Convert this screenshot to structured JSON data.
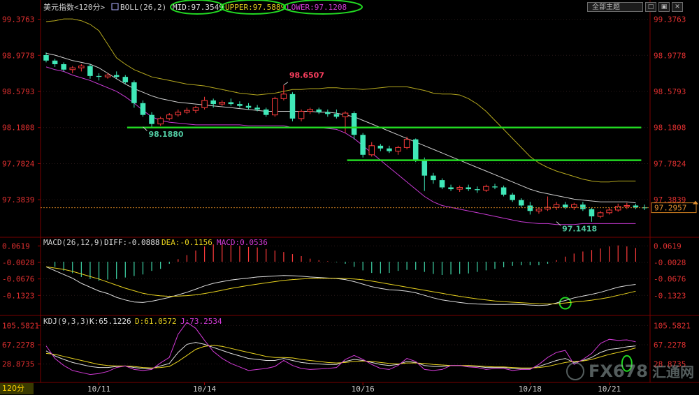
{
  "toolbar": {
    "theme_select": "全部主题",
    "btn1": "□",
    "btn2": "▣",
    "btn3": "✕"
  },
  "period_label": "120分",
  "watermark": {
    "brand": "FX678",
    "cn": "汇通网"
  },
  "chart_data": {
    "type": "candlestick",
    "title": "美元指数<120分>",
    "main": {
      "boll_label": "BOLL(26,2)",
      "mid_label": "MID:97.3549",
      "upper_label": "UPPER:97.5889",
      "lower_label": "LOWER:97.1208",
      "y_ticks": [
        "99.3763",
        "98.9778",
        "98.5793",
        "98.1808",
        "97.7824",
        "97.3839"
      ],
      "ylim": [
        97.0,
        99.45
      ],
      "last_price": "97.2957",
      "last_value": 97.2957,
      "annotations": [
        {
          "text": "98.6507",
          "value": 98.6507,
          "index": 27
        },
        {
          "text": "98.1880",
          "value": 98.188,
          "index": 11
        },
        {
          "text": "97.1418",
          "value": 97.1418,
          "index": 58
        }
      ],
      "hlines": [
        {
          "value": 98.1808,
          "from": 10,
          "to": 67
        },
        {
          "value": 97.82,
          "from": 35,
          "to": 67
        }
      ],
      "candles": [
        {
          "o": 98.98,
          "h": 99.01,
          "l": 98.9,
          "c": 98.92
        },
        {
          "o": 98.92,
          "h": 98.94,
          "l": 98.85,
          "c": 98.88
        },
        {
          "o": 98.88,
          "h": 98.9,
          "l": 98.8,
          "c": 98.82
        },
        {
          "o": 98.82,
          "h": 98.86,
          "l": 98.78,
          "c": 98.84
        },
        {
          "o": 98.84,
          "h": 98.88,
          "l": 98.8,
          "c": 98.86
        },
        {
          "o": 98.86,
          "h": 98.88,
          "l": 98.72,
          "c": 98.75
        },
        {
          "o": 98.75,
          "h": 98.78,
          "l": 98.7,
          "c": 98.74
        },
        {
          "o": 98.74,
          "h": 98.78,
          "l": 98.72,
          "c": 98.76
        },
        {
          "o": 98.76,
          "h": 98.8,
          "l": 98.72,
          "c": 98.74
        },
        {
          "o": 98.74,
          "h": 98.76,
          "l": 98.66,
          "c": 98.68
        },
        {
          "o": 98.68,
          "h": 98.7,
          "l": 98.4,
          "c": 98.45
        },
        {
          "o": 98.45,
          "h": 98.48,
          "l": 98.3,
          "c": 98.32
        },
        {
          "o": 98.32,
          "h": 98.35,
          "l": 98.19,
          "c": 98.22
        },
        {
          "o": 98.22,
          "h": 98.3,
          "l": 98.2,
          "c": 98.28
        },
        {
          "o": 98.28,
          "h": 98.34,
          "l": 98.26,
          "c": 98.32
        },
        {
          "o": 98.32,
          "h": 98.38,
          "l": 98.3,
          "c": 98.35
        },
        {
          "o": 98.35,
          "h": 98.4,
          "l": 98.33,
          "c": 98.37
        },
        {
          "o": 98.37,
          "h": 98.42,
          "l": 98.34,
          "c": 98.4
        },
        {
          "o": 98.4,
          "h": 98.52,
          "l": 98.38,
          "c": 98.48
        },
        {
          "o": 98.48,
          "h": 98.5,
          "l": 98.4,
          "c": 98.44
        },
        {
          "o": 98.44,
          "h": 98.48,
          "l": 98.42,
          "c": 98.46
        },
        {
          "o": 98.46,
          "h": 98.5,
          "l": 98.42,
          "c": 98.44
        },
        {
          "o": 98.44,
          "h": 98.47,
          "l": 98.4,
          "c": 98.42
        },
        {
          "o": 98.42,
          "h": 98.45,
          "l": 98.38,
          "c": 98.4
        },
        {
          "o": 98.4,
          "h": 98.43,
          "l": 98.36,
          "c": 98.38
        },
        {
          "o": 98.38,
          "h": 98.4,
          "l": 98.3,
          "c": 98.32
        },
        {
          "o": 98.32,
          "h": 98.52,
          "l": 98.3,
          "c": 98.5
        },
        {
          "o": 98.5,
          "h": 98.65,
          "l": 98.48,
          "c": 98.55
        },
        {
          "o": 98.55,
          "h": 98.57,
          "l": 98.25,
          "c": 98.28
        },
        {
          "o": 98.28,
          "h": 98.38,
          "l": 98.25,
          "c": 98.36
        },
        {
          "o": 98.36,
          "h": 98.4,
          "l": 98.33,
          "c": 98.38
        },
        {
          "o": 98.38,
          "h": 98.4,
          "l": 98.33,
          "c": 98.35
        },
        {
          "o": 98.35,
          "h": 98.38,
          "l": 98.3,
          "c": 98.33
        },
        {
          "o": 98.33,
          "h": 98.38,
          "l": 98.28,
          "c": 98.3
        },
        {
          "o": 98.3,
          "h": 98.36,
          "l": 98.12,
          "c": 98.34
        },
        {
          "o": 98.34,
          "h": 98.36,
          "l": 98.05,
          "c": 98.1
        },
        {
          "o": 98.1,
          "h": 98.12,
          "l": 97.85,
          "c": 97.88
        },
        {
          "o": 97.88,
          "h": 98.02,
          "l": 97.86,
          "c": 97.98
        },
        {
          "o": 97.98,
          "h": 98.0,
          "l": 97.92,
          "c": 97.95
        },
        {
          "o": 97.95,
          "h": 97.98,
          "l": 97.9,
          "c": 97.92
        },
        {
          "o": 97.92,
          "h": 97.98,
          "l": 97.88,
          "c": 97.96
        },
        {
          "o": 97.96,
          "h": 98.08,
          "l": 97.94,
          "c": 98.05
        },
        {
          "o": 98.05,
          "h": 98.06,
          "l": 97.8,
          "c": 97.82
        },
        {
          "o": 97.82,
          "h": 97.85,
          "l": 97.48,
          "c": 97.65
        },
        {
          "o": 97.65,
          "h": 97.68,
          "l": 97.56,
          "c": 97.6
        },
        {
          "o": 97.6,
          "h": 97.62,
          "l": 97.5,
          "c": 97.52
        },
        {
          "o": 97.52,
          "h": 97.55,
          "l": 97.48,
          "c": 97.5
        },
        {
          "o": 97.5,
          "h": 97.54,
          "l": 97.47,
          "c": 97.52
        },
        {
          "o": 97.52,
          "h": 97.55,
          "l": 97.48,
          "c": 97.5
        },
        {
          "o": 97.5,
          "h": 97.53,
          "l": 97.46,
          "c": 97.49
        },
        {
          "o": 97.49,
          "h": 97.55,
          "l": 97.47,
          "c": 97.53
        },
        {
          "o": 97.53,
          "h": 97.56,
          "l": 97.5,
          "c": 97.52
        },
        {
          "o": 97.52,
          "h": 97.54,
          "l": 97.42,
          "c": 97.44
        },
        {
          "o": 97.44,
          "h": 97.46,
          "l": 97.36,
          "c": 97.38
        },
        {
          "o": 97.38,
          "h": 97.4,
          "l": 97.3,
          "c": 97.32
        },
        {
          "o": 97.32,
          "h": 97.36,
          "l": 97.22,
          "c": 97.26
        },
        {
          "o": 97.26,
          "h": 97.3,
          "l": 97.23,
          "c": 97.28
        },
        {
          "o": 97.28,
          "h": 97.42,
          "l": 97.26,
          "c": 97.3
        },
        {
          "o": 97.3,
          "h": 97.36,
          "l": 97.27,
          "c": 97.33
        },
        {
          "o": 97.33,
          "h": 97.36,
          "l": 97.28,
          "c": 97.3
        },
        {
          "o": 97.3,
          "h": 97.35,
          "l": 97.27,
          "c": 97.33
        },
        {
          "o": 97.33,
          "h": 97.36,
          "l": 97.26,
          "c": 97.28
        },
        {
          "o": 97.28,
          "h": 97.3,
          "l": 97.14,
          "c": 97.2
        },
        {
          "o": 97.2,
          "h": 97.26,
          "l": 97.18,
          "c": 97.24
        },
        {
          "o": 97.24,
          "h": 97.3,
          "l": 97.22,
          "c": 97.27
        },
        {
          "o": 97.27,
          "h": 97.34,
          "l": 97.25,
          "c": 97.31
        },
        {
          "o": 97.31,
          "h": 97.35,
          "l": 97.28,
          "c": 97.32
        },
        {
          "o": 97.32,
          "h": 97.34,
          "l": 97.28,
          "c": 97.3
        },
        {
          "o": 97.3,
          "h": 97.33,
          "l": 97.27,
          "c": 97.29
        }
      ],
      "upper": [
        99.35,
        99.36,
        99.38,
        99.38,
        99.36,
        99.32,
        99.25,
        99.1,
        98.95,
        98.88,
        98.82,
        98.78,
        98.74,
        98.72,
        98.7,
        98.68,
        98.66,
        98.65,
        98.64,
        98.62,
        98.6,
        98.58,
        98.56,
        98.55,
        98.54,
        98.55,
        98.56,
        98.58,
        98.6,
        98.6,
        98.61,
        98.61,
        98.62,
        98.62,
        98.61,
        98.61,
        98.6,
        98.61,
        98.62,
        98.63,
        98.63,
        98.63,
        98.61,
        98.59,
        98.56,
        98.55,
        98.55,
        98.54,
        98.5,
        98.44,
        98.36,
        98.26,
        98.16,
        98.06,
        97.96,
        97.86,
        97.79,
        97.74,
        97.7,
        97.67,
        97.64,
        97.61,
        97.59,
        97.58,
        97.58,
        97.59,
        97.59,
        97.59
      ],
      "mid": [
        99.0,
        98.98,
        98.95,
        98.92,
        98.9,
        98.88,
        98.84,
        98.78,
        98.72,
        98.66,
        98.61,
        98.57,
        98.53,
        98.5,
        98.48,
        98.46,
        98.45,
        98.44,
        98.43,
        98.42,
        98.41,
        98.4,
        98.39,
        98.38,
        98.37,
        98.36,
        98.36,
        98.36,
        98.36,
        98.36,
        98.36,
        98.35,
        98.35,
        98.34,
        98.32,
        98.3,
        98.26,
        98.22,
        98.18,
        98.14,
        98.1,
        98.06,
        98.02,
        97.98,
        97.94,
        97.9,
        97.86,
        97.82,
        97.78,
        97.74,
        97.7,
        97.66,
        97.62,
        97.58,
        97.54,
        97.5,
        97.47,
        97.45,
        97.43,
        97.41,
        97.39,
        97.38,
        97.37,
        97.36,
        97.36,
        97.36,
        97.36,
        97.35
      ],
      "lower": [
        98.85,
        98.82,
        98.8,
        98.76,
        98.73,
        98.7,
        98.66,
        98.62,
        98.58,
        98.52,
        98.45,
        98.37,
        98.3,
        98.26,
        98.24,
        98.23,
        98.22,
        98.21,
        98.21,
        98.21,
        98.21,
        98.21,
        98.21,
        98.2,
        98.2,
        98.2,
        98.2,
        98.2,
        98.18,
        98.18,
        98.18,
        98.18,
        98.17,
        98.16,
        98.12,
        98.06,
        97.98,
        97.9,
        97.82,
        97.74,
        97.66,
        97.58,
        97.5,
        97.42,
        97.36,
        97.32,
        97.3,
        97.28,
        97.26,
        97.24,
        97.22,
        97.2,
        97.18,
        97.16,
        97.14,
        97.13,
        97.12,
        97.12,
        97.11,
        97.11,
        97.11,
        97.12,
        97.12,
        97.12,
        97.12,
        97.12,
        97.12,
        97.12
      ]
    },
    "macd": {
      "label": "MACD(26,12,9)",
      "diff_label": "DIFF:-0.0888",
      "dea_label": "DEA:-0.1156",
      "macd_label": "MACD:0.0536",
      "y_ticks": [
        "0.0619",
        "-0.0028",
        "-0.0676",
        "-0.1323"
      ],
      "ylim": [
        -0.2,
        0.085
      ],
      "diff": [
        -0.02,
        -0.035,
        -0.05,
        -0.065,
        -0.085,
        -0.1,
        -0.115,
        -0.125,
        -0.14,
        -0.15,
        -0.158,
        -0.16,
        -0.155,
        -0.148,
        -0.14,
        -0.13,
        -0.12,
        -0.108,
        -0.095,
        -0.085,
        -0.078,
        -0.072,
        -0.068,
        -0.064,
        -0.06,
        -0.058,
        -0.056,
        -0.054,
        -0.055,
        -0.057,
        -0.06,
        -0.062,
        -0.064,
        -0.066,
        -0.07,
        -0.078,
        -0.088,
        -0.098,
        -0.105,
        -0.11,
        -0.112,
        -0.116,
        -0.122,
        -0.132,
        -0.142,
        -0.15,
        -0.155,
        -0.16,
        -0.164,
        -0.166,
        -0.167,
        -0.168,
        -0.168,
        -0.167,
        -0.168,
        -0.17,
        -0.172,
        -0.17,
        -0.162,
        -0.152,
        -0.142,
        -0.135,
        -0.128,
        -0.12,
        -0.11,
        -0.1,
        -0.094,
        -0.089
      ],
      "dea": [
        -0.02,
        -0.025,
        -0.03,
        -0.038,
        -0.048,
        -0.058,
        -0.068,
        -0.08,
        -0.092,
        -0.104,
        -0.114,
        -0.124,
        -0.13,
        -0.134,
        -0.136,
        -0.135,
        -0.133,
        -0.13,
        -0.125,
        -0.119,
        -0.112,
        -0.105,
        -0.099,
        -0.093,
        -0.088,
        -0.083,
        -0.078,
        -0.073,
        -0.07,
        -0.068,
        -0.066,
        -0.065,
        -0.065,
        -0.065,
        -0.066,
        -0.068,
        -0.071,
        -0.076,
        -0.082,
        -0.088,
        -0.094,
        -0.1,
        -0.106,
        -0.112,
        -0.118,
        -0.124,
        -0.13,
        -0.136,
        -0.141,
        -0.146,
        -0.15,
        -0.154,
        -0.157,
        -0.159,
        -0.161,
        -0.163,
        -0.165,
        -0.166,
        -0.165,
        -0.162,
        -0.158,
        -0.155,
        -0.151,
        -0.146,
        -0.14,
        -0.132,
        -0.124,
        -0.116
      ],
      "hist": [
        0.0,
        -0.02,
        -0.035,
        -0.045,
        -0.06,
        -0.068,
        -0.075,
        -0.07,
        -0.068,
        -0.062,
        -0.056,
        -0.05,
        -0.036,
        -0.028,
        -0.008,
        0.01,
        0.026,
        0.044,
        0.06,
        0.068,
        0.068,
        0.066,
        0.062,
        0.058,
        0.056,
        0.05,
        0.044,
        0.038,
        0.03,
        0.022,
        0.012,
        0.006,
        0.002,
        -0.002,
        -0.008,
        -0.02,
        -0.034,
        -0.044,
        -0.046,
        -0.044,
        -0.036,
        -0.032,
        -0.032,
        -0.04,
        -0.048,
        -0.052,
        -0.05,
        -0.048,
        -0.046,
        -0.04,
        -0.034,
        -0.028,
        -0.022,
        -0.016,
        -0.014,
        -0.014,
        -0.014,
        -0.008,
        0.006,
        0.02,
        0.032,
        0.04,
        0.046,
        0.052,
        0.06,
        0.064,
        0.06,
        0.054
      ]
    },
    "kdj": {
      "label": "KDJ(9,3,3)",
      "k_label": "K:65.1226",
      "d_label": "D:61.0572",
      "j_label": "J:73.2534",
      "y_ticks": [
        "105.5821",
        "67.2278",
        "28.8735"
      ],
      "ylim": [
        -5,
        120
      ],
      "k": [
        55,
        45,
        38,
        32,
        28,
        24,
        22,
        22,
        24,
        25,
        22,
        20,
        20,
        25,
        30,
        52,
        68,
        72,
        68,
        62,
        56,
        50,
        45,
        40,
        38,
        36,
        36,
        40,
        36,
        32,
        30,
        29,
        28,
        28,
        34,
        38,
        36,
        32,
        28,
        26,
        28,
        34,
        32,
        26,
        24,
        24,
        26,
        26,
        25,
        24,
        22,
        22,
        22,
        20,
        20,
        20,
        24,
        30,
        36,
        40,
        32,
        36,
        42,
        52,
        58,
        60,
        63,
        65
      ],
      "d": [
        50,
        48,
        44,
        40,
        36,
        32,
        28,
        26,
        25,
        25,
        24,
        22,
        21,
        22,
        24,
        34,
        46,
        58,
        64,
        66,
        64,
        60,
        56,
        52,
        48,
        44,
        42,
        42,
        41,
        38,
        36,
        34,
        32,
        31,
        32,
        34,
        35,
        34,
        32,
        30,
        29,
        31,
        31,
        30,
        28,
        27,
        26,
        26,
        26,
        25,
        24,
        23,
        23,
        22,
        21,
        21,
        22,
        24,
        28,
        32,
        34,
        35,
        38,
        43,
        48,
        52,
        56,
        61
      ],
      "j": [
        65,
        40,
        26,
        16,
        12,
        8,
        10,
        14,
        22,
        25,
        18,
        16,
        18,
        31,
        42,
        88,
        112,
        100,
        76,
        54,
        40,
        30,
        23,
        16,
        18,
        20,
        24,
        36,
        26,
        20,
        18,
        19,
        20,
        22,
        38,
        46,
        38,
        28,
        20,
        18,
        26,
        40,
        34,
        18,
        16,
        18,
        26,
        26,
        23,
        22,
        18,
        20,
        20,
        16,
        18,
        18,
        28,
        42,
        52,
        56,
        28,
        38,
        50,
        70,
        78,
        76,
        77,
        73
      ]
    },
    "x_ticks": [
      {
        "label": "10/11",
        "index": 6
      },
      {
        "label": "10/14",
        "index": 18
      },
      {
        "label": "10/16",
        "index": 36
      },
      {
        "label": "10/18",
        "index": 55
      },
      {
        "label": "10/21",
        "index": 64
      }
    ],
    "highlight_circles": [
      {
        "panel": "macd",
        "index": 59,
        "value": -0.163
      },
      {
        "panel": "kdj",
        "index": 66,
        "value": 30
      }
    ]
  }
}
